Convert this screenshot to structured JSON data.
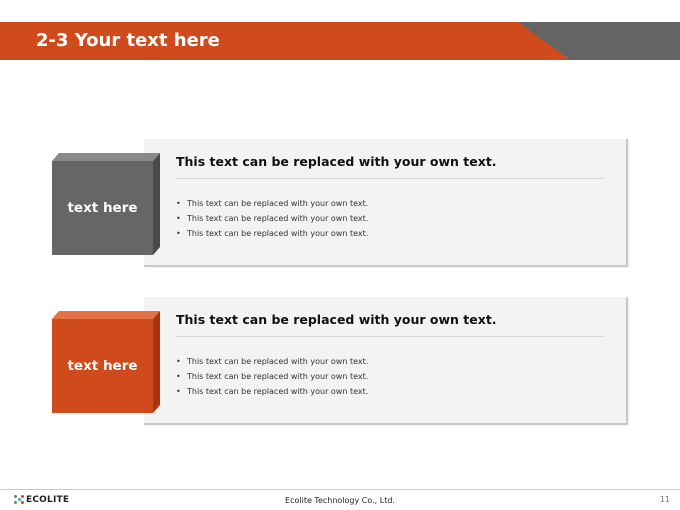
{
  "header": {
    "title": "2-3 Your text here"
  },
  "blocks": [
    {
      "label": "text here",
      "heading": "This text can be replaced with your own text.",
      "items": [
        "This text can be replaced with your own text.",
        "This text can be replaced with your own text.",
        "This text can be replaced with your own text."
      ]
    },
    {
      "label": "text here",
      "heading": "This text can be replaced with your own text.",
      "items": [
        "This text can be replaced with your own text.",
        "This text can be replaced with your own text.",
        "This text can be replaced with your own text."
      ]
    }
  ],
  "footer": {
    "logo_text": "ECOLITE",
    "company": "Ecolite Technology Co., Ltd.",
    "page_number": "11"
  },
  "colors": {
    "accent_orange": "#cf4a1c",
    "accent_gray": "#646464"
  },
  "icons": {
    "logo": "ecolite-dots-logo-icon"
  }
}
